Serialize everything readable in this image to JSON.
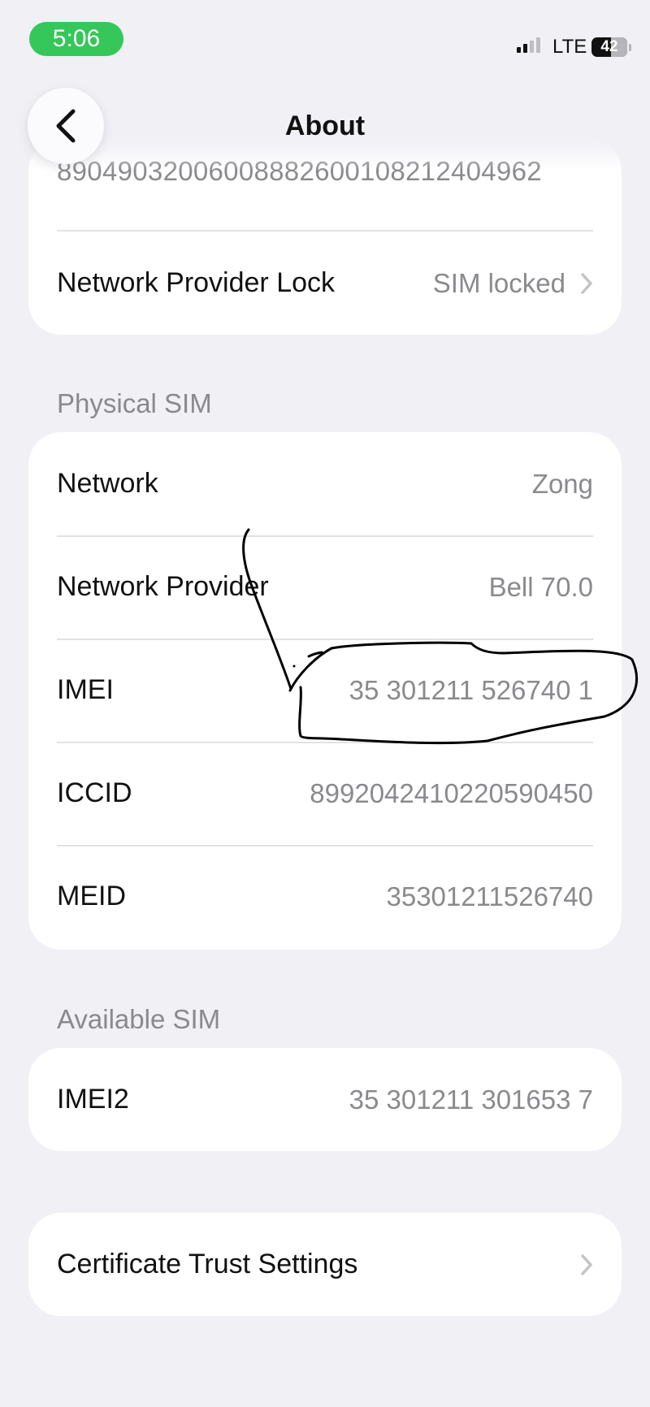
{
  "status_bar": {
    "time": "5:06",
    "network": "LTE",
    "battery": "42"
  },
  "nav": {
    "title": "About"
  },
  "top_card": {
    "partial_value": "89049032006008882600108212404962",
    "rows": [
      {
        "label": "Network Provider Lock",
        "value": "SIM locked"
      }
    ]
  },
  "physical_sim": {
    "header": "Physical SIM",
    "rows": [
      {
        "label": "Network",
        "value": "Zong"
      },
      {
        "label": "Network Provider",
        "value": "Bell 70.0"
      },
      {
        "label": "IMEI",
        "value": "35 301211 526740 1"
      },
      {
        "label": "ICCID",
        "value": "8992042410220590450"
      },
      {
        "label": "MEID",
        "value": "35301211526740"
      }
    ]
  },
  "available_sim": {
    "header": "Available SIM",
    "rows": [
      {
        "label": "IMEI2",
        "value": "35 301211 301653 7"
      }
    ]
  },
  "certificate_card": {
    "label": "Certificate Trust Settings"
  },
  "icons": {
    "back": "chevron-left-icon",
    "disclosure": "chevron-right-icon",
    "signal": "cellular-signal-icon",
    "battery": "battery-icon"
  },
  "colors": {
    "background": "#f0f0f5",
    "card": "#ffffff",
    "secondary_text": "#8a8a8e",
    "time_pill": "#35c759",
    "annotation_ink": "#000000"
  }
}
